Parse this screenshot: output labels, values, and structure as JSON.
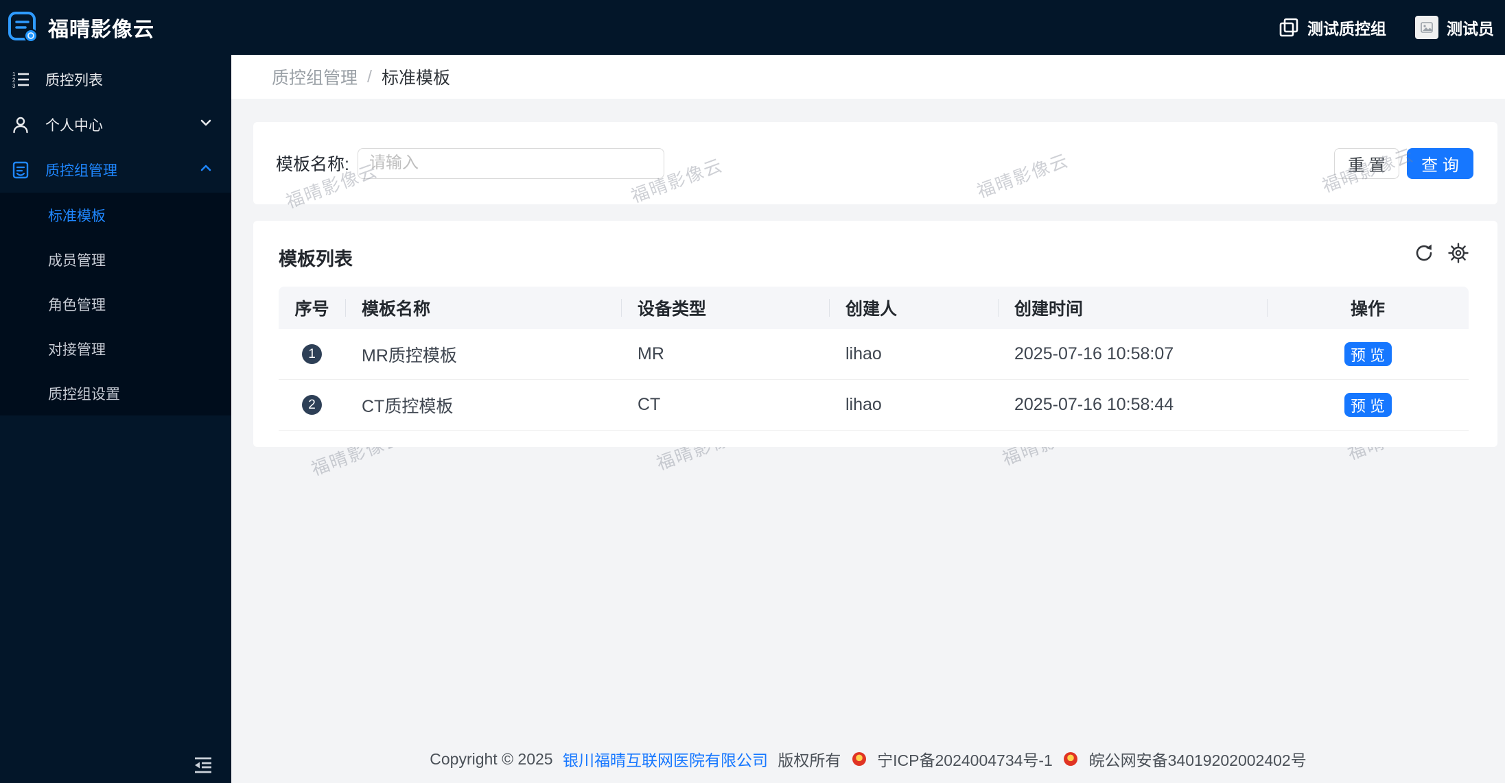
{
  "app": {
    "title": "福晴影像云"
  },
  "topbar": {
    "group_label": "测试质控组",
    "user_label": "测试员"
  },
  "sidebar": {
    "items": [
      {
        "label": "质控列表",
        "icon": "ordered-list-icon"
      },
      {
        "label": "个人中心",
        "icon": "user-icon"
      },
      {
        "label": "质控组管理",
        "icon": "document-icon"
      }
    ],
    "submenu": [
      {
        "label": "标准模板"
      },
      {
        "label": "成员管理"
      },
      {
        "label": "角色管理"
      },
      {
        "label": "对接管理"
      },
      {
        "label": "质控组设置"
      }
    ]
  },
  "breadcrumb": {
    "parent": "质控组管理",
    "separator": "/",
    "current": "标准模板"
  },
  "search": {
    "label": "模板名称:",
    "placeholder": "请输入",
    "value": "",
    "reset_label": "重 置",
    "query_label": "查 询"
  },
  "table": {
    "title": "模板列表",
    "columns": [
      "序号",
      "模板名称",
      "设备类型",
      "创建人",
      "创建时间",
      "操作"
    ],
    "rows": [
      {
        "index": "1",
        "name": "MR质控模板",
        "device": "MR",
        "creator": "lihao",
        "created": "2025-07-16 10:58:07",
        "action": "预 览"
      },
      {
        "index": "2",
        "name": "CT质控模板",
        "device": "CT",
        "creator": "lihao",
        "created": "2025-07-16 10:58:44",
        "action": "预 览"
      }
    ]
  },
  "footer": {
    "copyright": "Copyright © 2025",
    "company": "银川福晴互联网医院有限公司",
    "rights": "版权所有",
    "icp": "宁ICP备2024004734号-1",
    "police": "皖公网安备34019202002402号"
  },
  "watermark": {
    "text": "福晴影像云"
  },
  "colors": {
    "sidebar_bg": "#031629",
    "submenu_bg": "#000d1c",
    "accent_blue": "#1677ff",
    "active_menu_blue": "#1f87ff",
    "page_bg": "#f3f4f6",
    "badge_bg": "#2d3f56"
  }
}
